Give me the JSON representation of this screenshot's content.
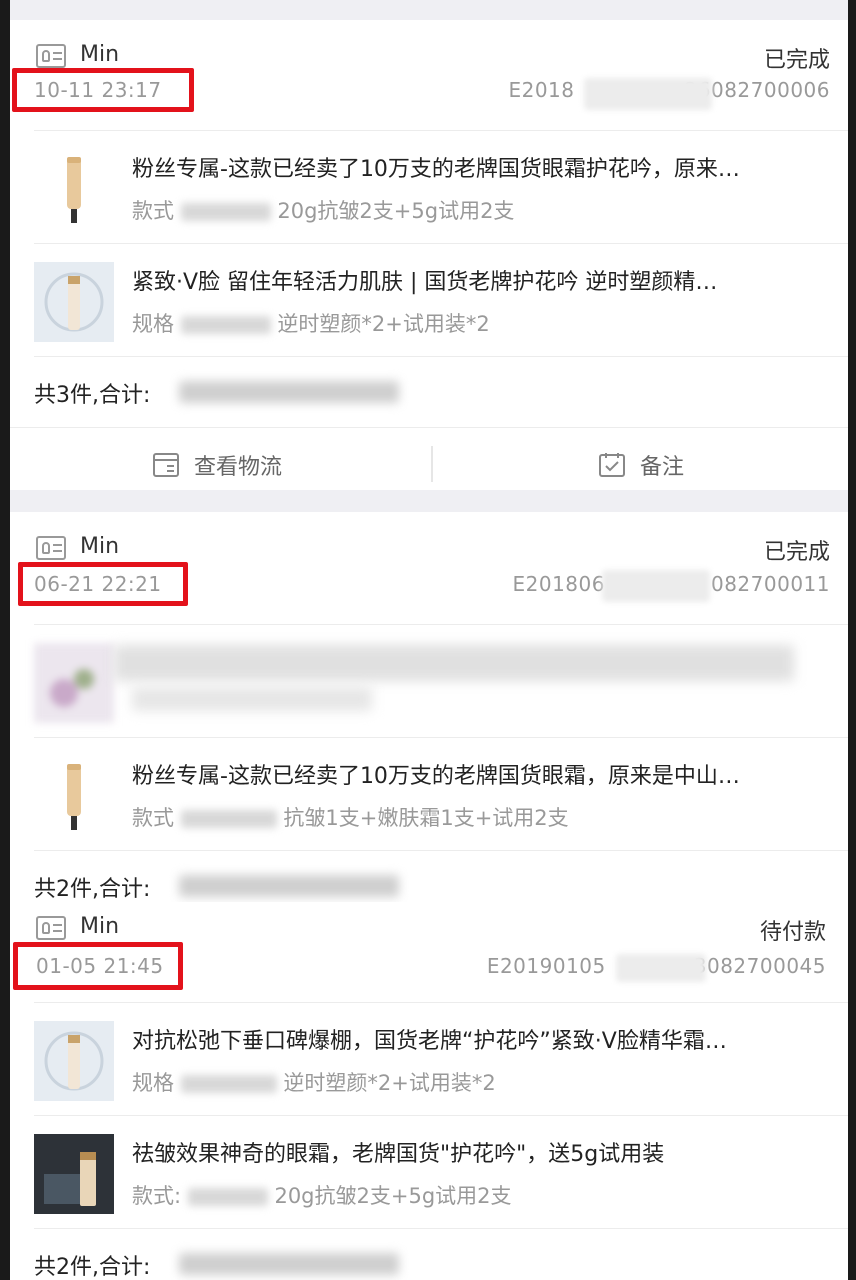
{
  "orders": [
    {
      "shop_name": "Min",
      "status": "已完成",
      "time": "10-11 23:17",
      "order_no_prefix": "E2018",
      "order_no_suffix": "26082700006",
      "items": [
        {
          "title": "粉丝专属-这款已经卖了10万支的老牌国货眼霜护花吟，原来…",
          "spec_label": "款式",
          "spec_value": "20g抗皱2支+5g试用2支",
          "thumb": "eye-cream-tube"
        },
        {
          "title": "紧致·V脸  留住年轻活力肌肤 | 国货老牌护花吟 逆时塑颜精…",
          "spec_label": "规格",
          "spec_value": "逆时塑颜*2+试用装*2",
          "thumb": "serum-bottle"
        }
      ],
      "total_label": "共3件,合计:",
      "actions": {
        "logistics": "查看物流",
        "note": "备注"
      }
    },
    {
      "shop_name": "Min",
      "status": "已完成",
      "time": "06-21 22:21",
      "order_no_prefix": "E201806",
      "order_no_suffix": "082700011",
      "items": [
        {
          "title": "",
          "spec_label": "",
          "spec_value": "",
          "thumb": "blurred-product"
        },
        {
          "title": "粉丝专属-这款已经卖了10万支的老牌国货眼霜，原来是中山…",
          "spec_label": "款式",
          "spec_value": "抗皱1支+嫩肤霜1支+试用2支",
          "thumb": "eye-cream-tube"
        }
      ],
      "total_label": "共2件,合计:"
    },
    {
      "shop_name": "Min",
      "status": "待付款",
      "time": "01-05 21:45",
      "order_no_prefix": "E20190105",
      "order_no_suffix": "3082700045",
      "items": [
        {
          "title": "对抗松弛下垂口碑爆棚，国货老牌“护花吟”紧致·V脸精华霜…",
          "spec_label": "规格",
          "spec_value": "逆时塑颜*2+试用装*2",
          "thumb": "serum-bottle"
        },
        {
          "title": "祛皱效果神奇的眼霜，老牌国货\"护花吟\"，送5g试用装",
          "spec_label": "款式:",
          "spec_value": "20g抗皱2支+5g试用2支",
          "thumb": "dark-product-photo"
        }
      ],
      "total_label": "共2件,合计:"
    }
  ],
  "colors": {
    "highlight": "#e3121b",
    "muted": "#999999",
    "divider": "#ececec"
  }
}
